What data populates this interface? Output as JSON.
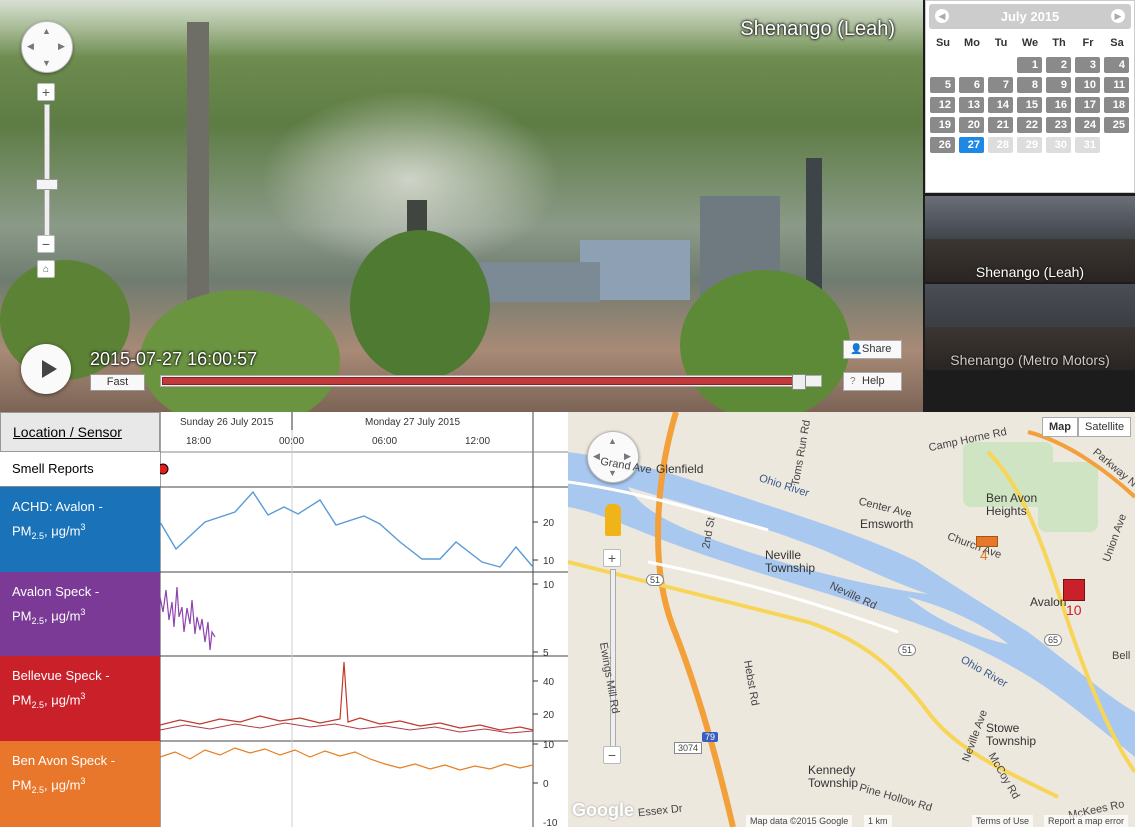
{
  "video": {
    "title": "Shenango (Leah)",
    "timestamp": "2015-07-27 16:00:57",
    "speed_label": "Fast",
    "share_label": "Share",
    "help_label": "Help",
    "playback_progress": 0.98,
    "zoom_in_label": "+",
    "zoom_out_label": "−"
  },
  "calendar": {
    "month_label": "July 2015",
    "weekdays": [
      "Su",
      "Mo",
      "Tu",
      "We",
      "Th",
      "Fr",
      "Sa"
    ],
    "weeks": [
      [
        "",
        "",
        "",
        "1",
        "2",
        "3",
        "4"
      ],
      [
        "5",
        "6",
        "7",
        "8",
        "9",
        "10",
        "11"
      ],
      [
        "12",
        "13",
        "14",
        "15",
        "16",
        "17",
        "18"
      ],
      [
        "19",
        "20",
        "21",
        "22",
        "23",
        "24",
        "25"
      ],
      [
        "26",
        "27",
        "28",
        "29",
        "30",
        "31",
        ""
      ]
    ],
    "selected_day": "27",
    "disabled_days": [
      "28",
      "29",
      "30",
      "31"
    ],
    "selected_color": "#1e88e5"
  },
  "cameras": [
    {
      "label": "Shenango (Leah)"
    },
    {
      "label": "Shenango (Metro Motors)"
    }
  ],
  "sensors": {
    "header_label": "Location / Sensor",
    "date_labels": [
      "Sunday 26 July 2015",
      "Monday 27 July 2015"
    ],
    "time_ticks": [
      "18:00",
      "00:00",
      "06:00",
      "12:00"
    ],
    "smell_label": "Smell Reports",
    "rows": [
      {
        "name": "ACHD: Avalon -",
        "unit_prefix": "PM",
        "unit_sub": "2.5",
        "unit_suffix": ", μg/m",
        "unit_sup": "3",
        "color": "#1a73b8",
        "line_color": "#5b9bd5",
        "ticks": [
          "20",
          "10"
        ]
      },
      {
        "name": "Avalon Speck -",
        "unit_prefix": "PM",
        "unit_sub": "2.5",
        "unit_suffix": ", μg/m",
        "unit_sup": "3",
        "color": "#7a3a96",
        "line_color": "#8e44ad",
        "ticks": [
          "10",
          "5"
        ]
      },
      {
        "name": "Bellevue Speck -",
        "unit_prefix": "PM",
        "unit_sub": "2.5",
        "unit_suffix": ", μg/m",
        "unit_sup": "3",
        "color": "#c9202a",
        "line_color": "#c0392b",
        "ticks": [
          "40",
          "20"
        ]
      },
      {
        "name": "Ben Avon Speck -",
        "unit_prefix": "PM",
        "unit_sub": "2.5",
        "unit_suffix": ", μg/m",
        "unit_sup": "3",
        "color": "#e8762b",
        "line_color": "#e67e22",
        "ticks": [
          "10",
          "0",
          "-10"
        ]
      }
    ]
  },
  "map": {
    "type_map": "Map",
    "type_satellite": "Satellite",
    "labels": {
      "glenfield": "Glenfield",
      "ben_avon": "Ben Avon Heights",
      "emsworth": "Emsworth",
      "neville": "Neville Township",
      "avalon": "Avalon",
      "stowe": "Stowe Township",
      "kennedy": "Kennedy Township",
      "ohio_river_1": "Ohio River",
      "ohio_river_2": "Ohio River",
      "grand_ave": "Grand Ave",
      "camp_horne": "Camp Horne Rd",
      "parkway": "Parkway N",
      "center_ave": "Center Ave",
      "church_ave": "Church Ave",
      "union_ave": "Union Ave",
      "neville_rd": "Neville Rd",
      "toms_run": "Toms Run Rd",
      "second_st": "2nd St",
      "hebst_rd": "Hebst Rd",
      "ewings_mill": "Ewings Mill Rd",
      "essex": "Essex Dr",
      "pine_hollow": "Pine Hollow Rd",
      "mccoy": "McCoy Rd",
      "mckees": "McKees Ro",
      "neville_ave": "Neville Ave",
      "route_51": "51",
      "route_65": "65",
      "route_3074": "3074",
      "i79": "79",
      "bell": "Bell"
    },
    "markers": [
      {
        "value": "4",
        "color": "#e8762b"
      },
      {
        "value": "10",
        "color": "#c9202a"
      }
    ],
    "footer": {
      "google": "Google",
      "data": "Map data ©2015 Google",
      "scale": "1 km",
      "terms": "Terms of Use",
      "report": "Report a map error"
    }
  }
}
